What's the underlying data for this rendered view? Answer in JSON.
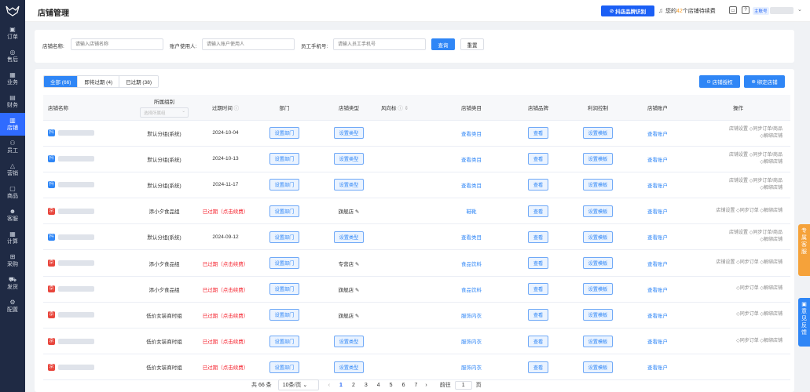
{
  "sidebar": {
    "items": [
      {
        "icon": "▣",
        "label": "订单"
      },
      {
        "icon": "◎",
        "label": "售后"
      },
      {
        "icon": "▦",
        "label": "业务"
      },
      {
        "icon": "▤",
        "label": "财务"
      },
      {
        "icon": "▥",
        "label": "店铺"
      },
      {
        "icon": "⚇",
        "label": "员工"
      },
      {
        "icon": "△",
        "label": "营销"
      },
      {
        "icon": "▢",
        "label": "商品"
      },
      {
        "icon": "☻",
        "label": "客服"
      },
      {
        "icon": "▦",
        "label": "计算"
      },
      {
        "icon": "⊞",
        "label": "采购"
      },
      {
        "icon": "⛟",
        "label": "发货"
      },
      {
        "icon": "⚙",
        "label": "配置"
      }
    ]
  },
  "header": {
    "title": "店铺管理",
    "brand_btn": "抖店品牌识别",
    "renew_pre": "您的",
    "renew_num": "42",
    "renew_post": "个店铺待续费",
    "shop_tag": "主账号"
  },
  "filter": {
    "shop_name_label": "店铺名称:",
    "shop_name_ph": "请输入店铺名称",
    "user_label": "账户使用人:",
    "user_ph": "请输入账户使用人",
    "phone_label": "员工手机号:",
    "phone_ph": "请输入员工手机号",
    "query": "查询",
    "reset": "重置"
  },
  "tabs": [
    {
      "label": "全部 (66)"
    },
    {
      "label": "即将过期 (4)"
    },
    {
      "label": "已过期 (38)"
    }
  ],
  "actions": {
    "auth": "店铺授权",
    "bind": "绑定店铺"
  },
  "columns": {
    "name": "店铺名称",
    "group": "所属组别",
    "group_ph": "选择所属组",
    "expire": "过期时间",
    "dept": "部门",
    "type": "店铺类型",
    "risk": "风向标",
    "cat": "店铺类目",
    "brand": "店铺品牌",
    "profit": "利润控制",
    "acct": "店铺账户",
    "ops": "操作"
  },
  "rows": [
    {
      "badge": "抖",
      "bc": "#2f86f6",
      "group": "默认分组(系统)",
      "expire": "2024-10-04",
      "red": false,
      "dept": "设置部门",
      "type": "设置类型",
      "type_btn": true,
      "cat": "查看类目",
      "brand": "查看",
      "profit": "设置模板",
      "acct": "查看账户",
      "ops": [
        "店铺设置 ◇同步订单/商品",
        "◇解绑店铺"
      ]
    },
    {
      "badge": "抖",
      "bc": "#2f86f6",
      "group": "默认分组(系统)",
      "expire": "2024-10-13",
      "red": false,
      "dept": "设置部门",
      "type": "设置类型",
      "type_btn": true,
      "cat": "查看类目",
      "brand": "查看",
      "profit": "设置模板",
      "acct": "查看账户",
      "ops": [
        "店铺设置 ◇同步订单/商品",
        "◇解绑店铺"
      ]
    },
    {
      "badge": "抖",
      "bc": "#2f86f6",
      "group": "默认分组(系统)",
      "expire": "2024-11-17",
      "red": false,
      "dept": "设置部门",
      "type": "设置类型",
      "type_btn": true,
      "cat": "查看类目",
      "brand": "查看",
      "profit": "设置模板",
      "acct": "查看账户",
      "ops": [
        "店铺设置 ◇同步订单/商品",
        "◇解绑店铺"
      ]
    },
    {
      "badge": "京",
      "bc": "#e8453c",
      "group": "添小夕食品组",
      "expire": "已过期（点击续费）",
      "red": true,
      "dept": "设置部门",
      "type": "旗舰店 ✎",
      "type_btn": false,
      "cat": "鞋靴",
      "brand": "查看",
      "profit": "设置模板",
      "acct": "查看账户",
      "ops": [
        "店铺设置 ◇同步订单 ◇解绑店铺"
      ]
    },
    {
      "badge": "抖",
      "bc": "#2f86f6",
      "group": "默认分组(系统)",
      "expire": "2024-09-12",
      "red": false,
      "dept": "设置部门",
      "type": "设置类型",
      "type_btn": true,
      "cat": "查看类目",
      "brand": "查看",
      "profit": "设置模板",
      "acct": "查看账户",
      "ops": [
        "店铺设置 ◇同步订单/商品",
        "◇解绑店铺"
      ]
    },
    {
      "badge": "京",
      "bc": "#e8453c",
      "group": "添小夕食品组",
      "expire": "已过期（点击续费）",
      "red": true,
      "dept": "设置部门",
      "type": "专营店 ✎",
      "type_btn": false,
      "cat": "食品饮料",
      "brand": "查看",
      "profit": "设置模板",
      "acct": "查看账户",
      "ops": [
        "店铺设置 ◇同步订单 ◇解绑店铺"
      ]
    },
    {
      "badge": "京",
      "bc": "#e8453c",
      "group": "添小夕食品组",
      "expire": "已过期（点击续费）",
      "red": true,
      "dept": "设置部门",
      "type": "旗舰店 ✎",
      "type_btn": false,
      "cat": "食品饮料",
      "brand": "查看",
      "profit": "设置模板",
      "acct": "查看账户",
      "ops": [
        "◇同步订单 ◇解绑店铺"
      ]
    },
    {
      "badge": "京",
      "bc": "#e8453c",
      "group": "低价女装商时组",
      "expire": "已过期（点击续费）",
      "red": true,
      "dept": "设置部门",
      "type": "旗舰店 ✎",
      "type_btn": false,
      "cat": "服饰内衣",
      "brand": "查看",
      "profit": "设置模板",
      "acct": "查看账户",
      "ops": [
        "◇同步订单 ◇解绑店铺"
      ]
    },
    {
      "badge": "京",
      "bc": "#e8453c",
      "group": "低价女装商时组",
      "expire": "已过期（点击续费）",
      "red": true,
      "dept": "设置部门",
      "type": "设置类型",
      "type_btn": true,
      "cat": "服饰内衣",
      "brand": "查看",
      "profit": "设置模板",
      "acct": "查看账户",
      "ops": [
        "◇同步订单 ◇解绑店铺"
      ]
    },
    {
      "badge": "京",
      "bc": "#e8453c",
      "group": "低价女装商时组",
      "expire": "已过期（点击续费）",
      "red": true,
      "dept": "设置部门",
      "type": "设置类型",
      "type_btn": true,
      "cat": "服饰内衣",
      "brand": "查看",
      "profit": "设置模板",
      "acct": "查看账户",
      "ops": [
        ""
      ]
    }
  ],
  "pager": {
    "total": "共 66 条",
    "size": "10条/页",
    "pages": [
      "1",
      "2",
      "3",
      "4",
      "5",
      "6",
      "7"
    ],
    "goto": "前往",
    "page": "1",
    "unit": "页"
  },
  "float": {
    "a": "专属客服",
    "b": "意见反馈"
  }
}
